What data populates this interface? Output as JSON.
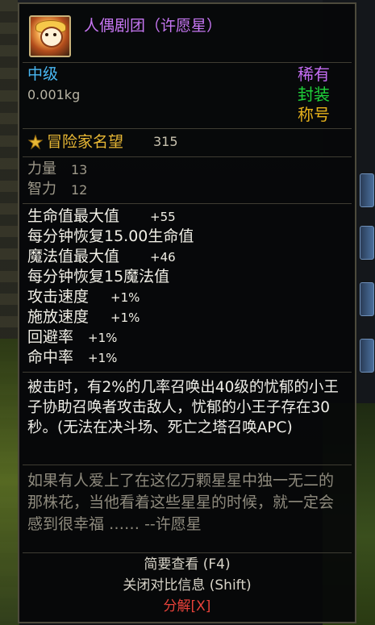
{
  "item": {
    "name": "人偶剧团（许愿星）",
    "grade": "中级",
    "weight": "0.001kg",
    "rarity": "稀有",
    "seal": "封装",
    "type": "称号",
    "icon": "doll-portrait-icon"
  },
  "fame": {
    "label": "冒险家名望",
    "value": "315",
    "icon": "fame-emblem-icon"
  },
  "base_stats": [
    {
      "label": "力量",
      "value": "13"
    },
    {
      "label": "智力",
      "value": "12"
    }
  ],
  "bonuses": [
    {
      "label": "生命值最大值",
      "value": "+55"
    },
    {
      "label": "每分钟恢复15.00生命值",
      "value": ""
    },
    {
      "label": "魔法值最大值",
      "value": "+46"
    },
    {
      "label": "每分钟恢复15魔法值",
      "value": ""
    },
    {
      "label": "攻击速度",
      "value": "+1%"
    },
    {
      "label": "施放速度",
      "value": "+1%"
    },
    {
      "label": "回避率",
      "value": "+1%"
    },
    {
      "label": "命中率",
      "value": "+1%"
    }
  ],
  "description": "被击时，有2%的几率召唤出40级的忧郁的小王子协助召唤者攻击敌人，忧郁的小王子存在30秒。(无法在决斗场、死亡之塔召唤APC)",
  "flavor": "如果有人爱上了在这亿万颗星星中独一无二的那株花，当他看着这些星星的时候，就一定会感到很幸福 …… --许愿星",
  "footer": {
    "brief_view": "简要查看 (F4)",
    "close_compare": "关闭对比信息 (Shift)",
    "disassemble": "分解[X]"
  },
  "colors": {
    "name": "#c676f2",
    "grade": "#49b8f3",
    "rarity": "#c46df2",
    "seal": "#1fd23a",
    "type": "#e6b11b",
    "fame": "#e8b835",
    "disassemble": "#e8423a"
  }
}
